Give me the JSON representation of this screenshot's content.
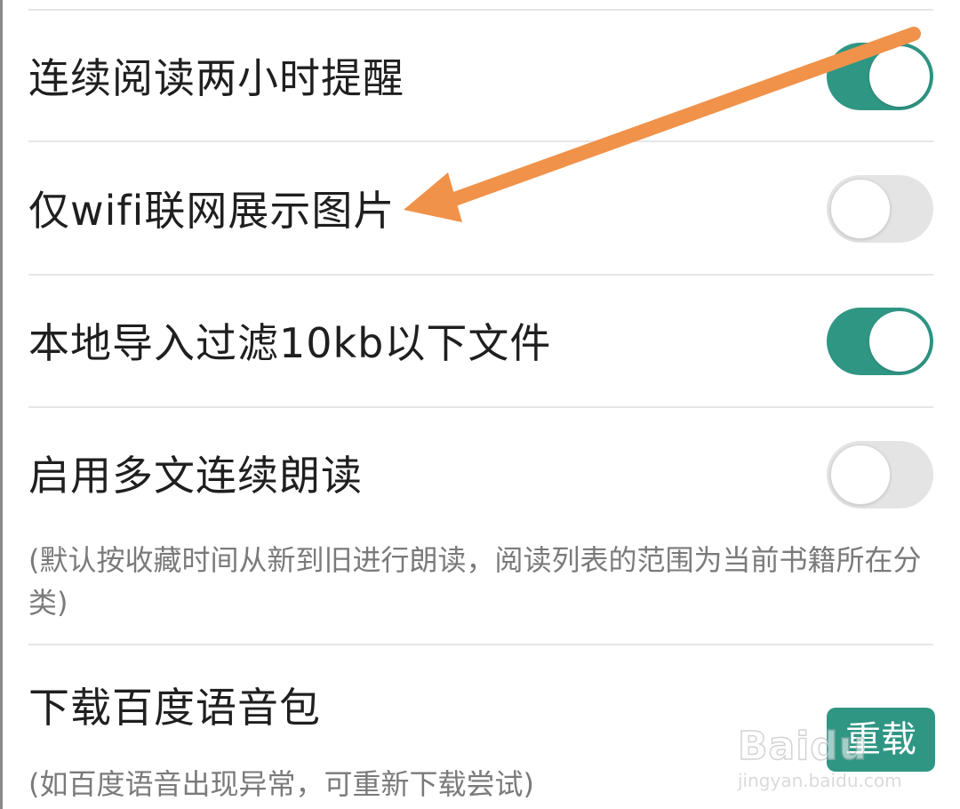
{
  "settings": {
    "items": [
      {
        "label": "连续阅读两小时提醒",
        "state": "on"
      },
      {
        "label": "仅wifi联网展示图片",
        "state": "off"
      },
      {
        "label": "本地导入过滤10kb以下文件",
        "state": "on"
      },
      {
        "label": "启用多文连续朗读",
        "state": "off",
        "description": "(默认按收藏时间从新到旧进行朗读，阅读列表的范围为当前书籍所在分类)"
      },
      {
        "label": "下载百度语音包",
        "action_label": "重载",
        "description": "(如百度语音出现异常，可重新下载尝试)"
      }
    ]
  },
  "watermark": {
    "logo_text": "Baidu",
    "sub_text": "jingyan.baidu.com"
  },
  "colors": {
    "accent": "#2f9684",
    "toggle_off": "#e4e4e4",
    "annotation_arrow": "#f0924a",
    "label_text": "#1f1f1f",
    "description_text": "#7a7a7a"
  },
  "icons": {
    "annotation": "arrow-annotation-icon"
  }
}
